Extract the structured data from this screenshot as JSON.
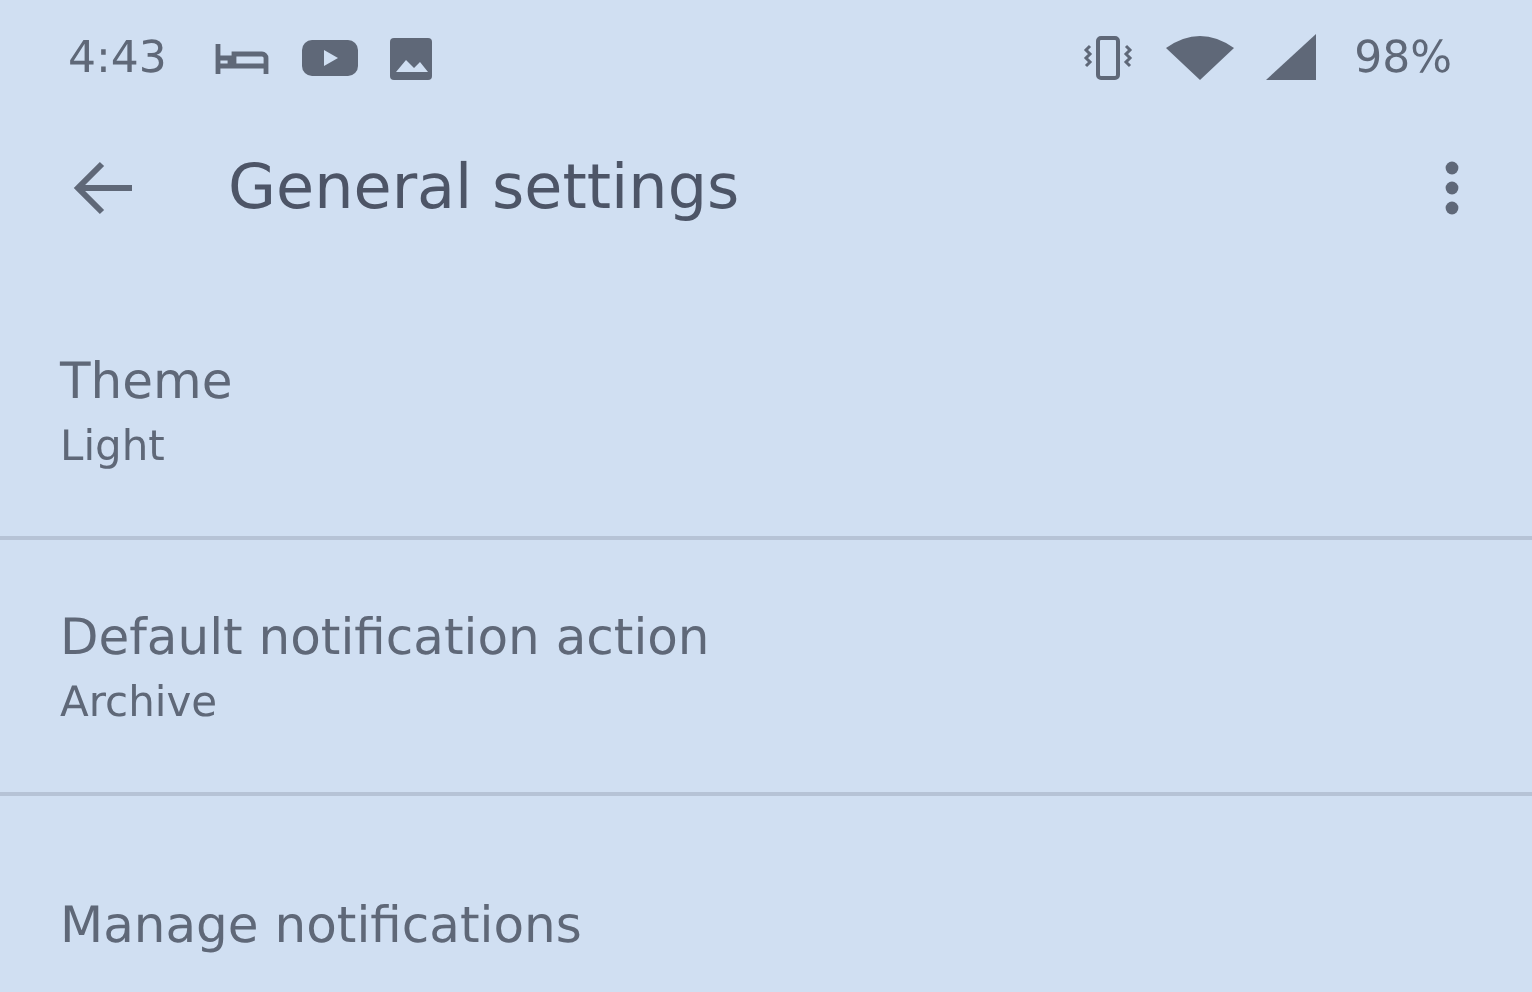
{
  "status_bar": {
    "time": "4:43",
    "battery": "98%"
  },
  "app_bar": {
    "title": "General settings"
  },
  "settings": [
    {
      "title": "Theme",
      "summary": "Light"
    },
    {
      "title": "Default notification action",
      "summary": "Archive"
    },
    {
      "title": "Manage notifications"
    }
  ]
}
